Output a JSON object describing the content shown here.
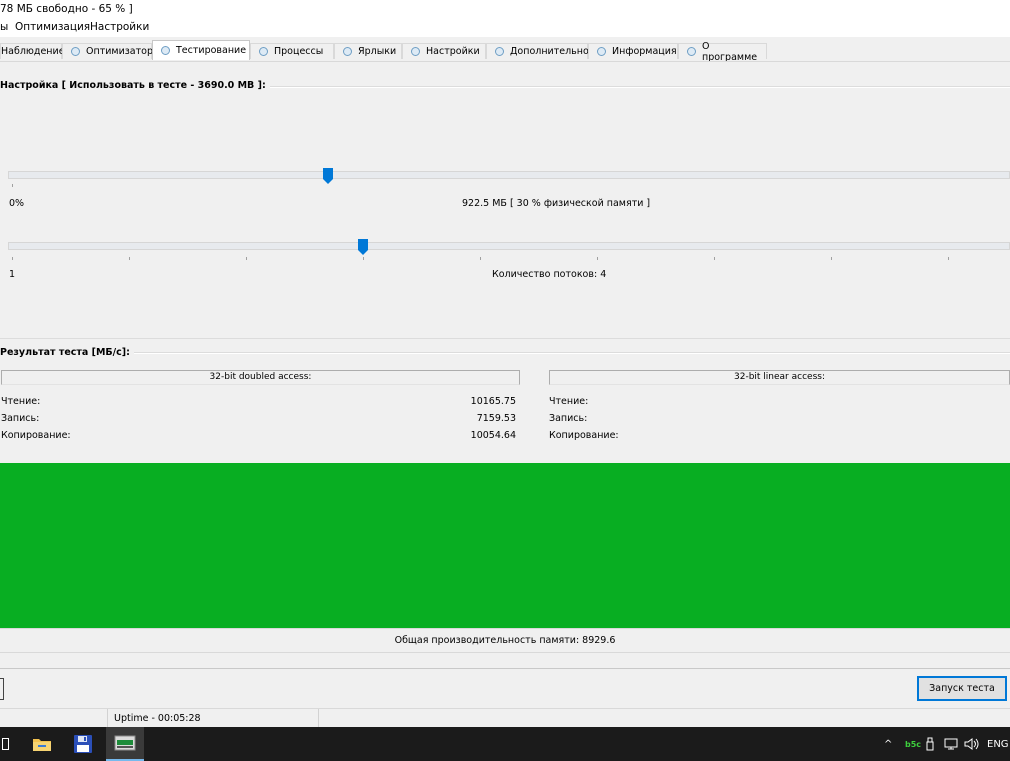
{
  "window": {
    "title_fragment": "78 МБ свободно - 65 % ]"
  },
  "menu": {
    "items": [
      "ы",
      "Оптимизация",
      "Настройки"
    ]
  },
  "tabs": [
    {
      "label": "Наблюдение",
      "active": false
    },
    {
      "label": "Оптимизатор",
      "active": false
    },
    {
      "label": "Тестирование",
      "active": true
    },
    {
      "label": "Процессы",
      "active": false
    },
    {
      "label": "Ярлыки",
      "active": false
    },
    {
      "label": "Настройки",
      "active": false
    },
    {
      "label": "Дополнительно",
      "active": false
    },
    {
      "label": "Информация",
      "active": false
    },
    {
      "label": "О программе",
      "active": false
    }
  ],
  "settings": {
    "group_title": "Настройка [ Использовать в тесте - 3690.0 MB ]:",
    "memory_slider": {
      "min_label": "0%",
      "value_label": "922.5 МБ [ 30 % физической памяти ]",
      "percent": 30
    },
    "threads_slider": {
      "min_label": "1",
      "value_label": "Количество потоков: 4",
      "value": 4
    }
  },
  "results": {
    "group_title": "Результат теста [МБ/с]:",
    "doubled": {
      "header": "32-bit doubled access:",
      "rows": [
        {
          "label": "Чтение:",
          "value": "10165.75"
        },
        {
          "label": "Запись:",
          "value": "7159.53"
        },
        {
          "label": "Копирование:",
          "value": "10054.64"
        }
      ]
    },
    "linear": {
      "header": "32-bit linear access:",
      "rows": [
        {
          "label": "Чтение:",
          "value": ""
        },
        {
          "label": "Запись:",
          "value": ""
        },
        {
          "label": "Копирование:",
          "value": ""
        }
      ]
    }
  },
  "gauge": {
    "color": "#08ae22"
  },
  "performance": {
    "label": "Общая производительность памяти: 8929.6"
  },
  "actions": {
    "run_label": "Запуск теста"
  },
  "status": {
    "uptime": "Uptime - 00:05:28"
  },
  "taskbar": {
    "tray": {
      "lang": "ENG",
      "caret": "^",
      "app_badge": "b5c"
    }
  }
}
